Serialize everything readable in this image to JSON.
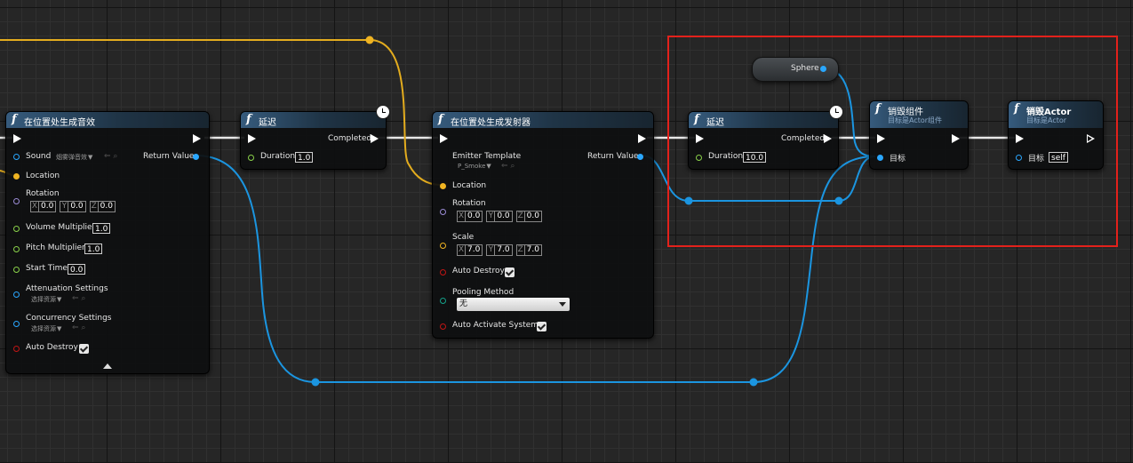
{
  "nodes": {
    "spawn_sound": {
      "title": "在位置处生成音效",
      "pins": {
        "sound": "Sound",
        "sound_asset": "烟雾弹音效",
        "location": "Location",
        "rotation": "Rotation",
        "rotation_x": "0.0",
        "rotation_y": "0.0",
        "rotation_z": "0.0",
        "volume": "Volume Multiplier",
        "volume_value": "1.0",
        "pitch": "Pitch Multiplier",
        "pitch_value": "1.0",
        "start_time": "Start Time",
        "start_time_value": "0.0",
        "attenuation": "Attenuation Settings",
        "attenuation_asset": "选择资源",
        "concurrency": "Concurrency Settings",
        "concurrency_asset": "选择资源",
        "auto_destroy": "Auto Destroy",
        "return_value": "Return Value"
      }
    },
    "delay_1": {
      "title": "延迟",
      "completed": "Completed",
      "duration": "Duration",
      "duration_value": "1.0"
    },
    "spawn_emitter": {
      "title": "在位置处生成发射器",
      "pins": {
        "emitter_template": "Emitter Template",
        "emitter_asset": "P_Smoke",
        "return_value": "Return Value",
        "location": "Location",
        "rotation": "Rotation",
        "rotation_x": "0.0",
        "rotation_y": "0.0",
        "rotation_z": "0.0",
        "scale": "Scale",
        "scale_x": "7.0",
        "scale_y": "7.0",
        "scale_z": "7.0",
        "auto_destroy": "Auto Destroy",
        "pooling_method": "Pooling Method",
        "pooling_value": "无",
        "auto_activate": "Auto Activate System"
      }
    },
    "delay_2": {
      "title": "延迟",
      "completed": "Completed",
      "duration": "Duration",
      "duration_value": "10.0"
    },
    "sphere": {
      "label": "Sphere"
    },
    "destroy_component": {
      "title": "销毁组件",
      "subtitle": "目标是Actor组件",
      "target": "目标"
    },
    "destroy_actor": {
      "title": "销毁Actor",
      "subtitle": "目标是Actor",
      "target": "目标",
      "target_value": "self"
    }
  },
  "axes": {
    "x": "X",
    "y": "Y",
    "z": "Z"
  },
  "colors": {
    "exec": "#ffffff",
    "object_pin": "#2aa7ff",
    "vector_pin": "#f0b422",
    "rotator_pin": "#9b8cd6",
    "float_pin": "#8ad24a",
    "bool_pin": "#c21515",
    "enum_pin": "#14a28a",
    "highlight": "#e3211b"
  }
}
